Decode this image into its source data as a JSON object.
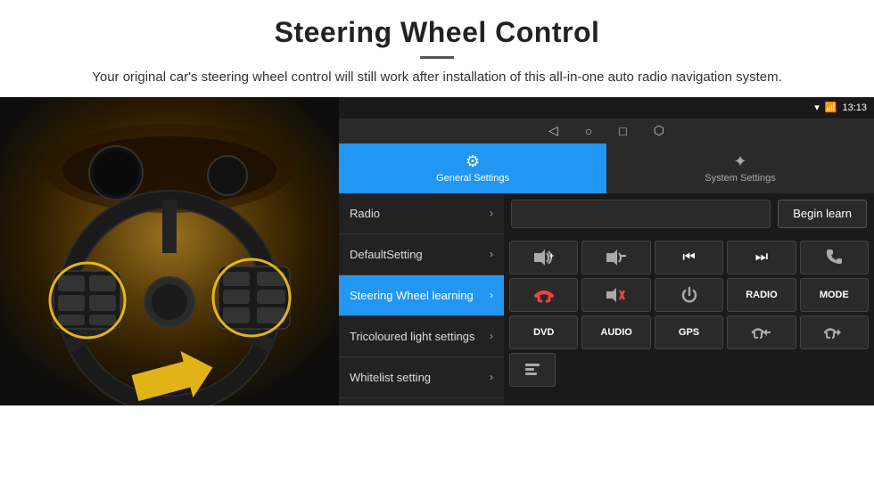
{
  "header": {
    "title": "Steering Wheel Control",
    "subtitle": "Your original car's steering wheel control will still work after installation of this all-in-one auto radio navigation system.",
    "divider": true
  },
  "status_bar": {
    "time": "13:13",
    "icons": [
      "signal",
      "wifi",
      "battery"
    ]
  },
  "nav_bar": {
    "back_icon": "◁",
    "home_icon": "○",
    "recent_icon": "□",
    "cast_icon": "⬡"
  },
  "tabs": [
    {
      "id": "general",
      "label": "General Settings",
      "active": true,
      "icon": "⚙"
    },
    {
      "id": "system",
      "label": "System Settings",
      "active": false,
      "icon": "☆"
    }
  ],
  "menu": {
    "items": [
      {
        "id": "radio",
        "label": "Radio",
        "active": false
      },
      {
        "id": "default",
        "label": "DefaultSetting",
        "active": false
      },
      {
        "id": "steering",
        "label": "Steering Wheel learning",
        "active": true
      },
      {
        "id": "tricoloured",
        "label": "Tricoloured light settings",
        "active": false
      },
      {
        "id": "whitelist",
        "label": "Whitelist setting",
        "active": false
      }
    ]
  },
  "controls": {
    "begin_learn_label": "Begin learn",
    "input_placeholder": "",
    "button_rows": [
      [
        {
          "id": "vol-up",
          "icon": "🔊+",
          "type": "icon"
        },
        {
          "id": "vol-down",
          "icon": "🔊−",
          "type": "icon"
        },
        {
          "id": "prev-track",
          "icon": "⏮",
          "type": "icon"
        },
        {
          "id": "next-track",
          "icon": "⏭",
          "type": "icon"
        },
        {
          "id": "phone",
          "icon": "📞",
          "type": "icon"
        }
      ],
      [
        {
          "id": "hang-up",
          "icon": "☎",
          "type": "icon"
        },
        {
          "id": "mute",
          "icon": "🔇×",
          "type": "icon"
        },
        {
          "id": "power",
          "icon": "⏻",
          "type": "icon"
        },
        {
          "id": "radio-btn",
          "label": "RADIO",
          "type": "text"
        },
        {
          "id": "mode-btn",
          "label": "MODE",
          "type": "text"
        }
      ],
      [
        {
          "id": "dvd-btn",
          "label": "DVD",
          "type": "text"
        },
        {
          "id": "audio-btn",
          "label": "AUDIO",
          "type": "text"
        },
        {
          "id": "gps-btn",
          "label": "GPS",
          "type": "text"
        },
        {
          "id": "tel-prev",
          "icon": "📞⏮",
          "type": "icon"
        },
        {
          "id": "tel-next",
          "icon": "📞⏭",
          "type": "icon"
        }
      ],
      [
        {
          "id": "extra-btn",
          "icon": "≡",
          "type": "icon"
        }
      ]
    ]
  }
}
